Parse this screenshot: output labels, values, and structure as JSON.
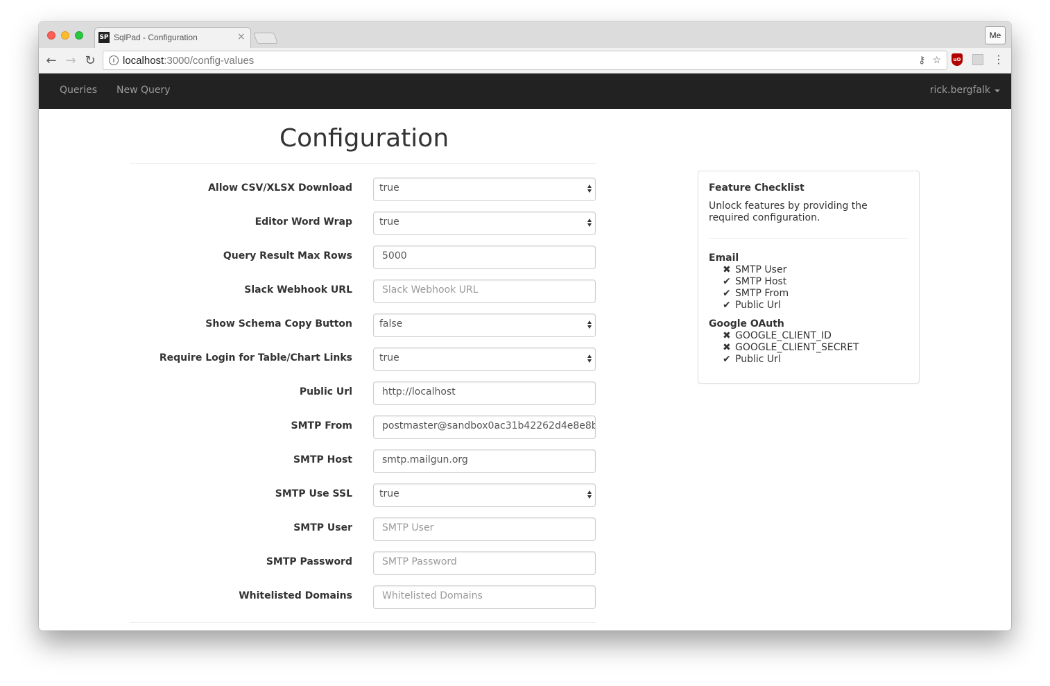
{
  "browser": {
    "tab_title": "SqlPad - Configuration",
    "favicon_text": "SP",
    "url_host": "localhost",
    "url_path": ":3000/config-values",
    "profile_label": "Me"
  },
  "navbar": {
    "queries": "Queries",
    "new_query": "New Query",
    "user": "rick.bergfalk"
  },
  "page": {
    "title": "Configuration"
  },
  "form": {
    "rows": [
      {
        "label": "Allow CSV/XLSX Download",
        "type": "select",
        "value": "true"
      },
      {
        "label": "Editor Word Wrap",
        "type": "select",
        "value": "true"
      },
      {
        "label": "Query Result Max Rows",
        "type": "input",
        "value": "5000"
      },
      {
        "label": "Slack Webhook URL",
        "type": "input",
        "placeholder": "Slack Webhook URL"
      },
      {
        "label": "Show Schema Copy Button",
        "type": "select",
        "value": "false"
      },
      {
        "label": "Require Login for Table/Chart Links",
        "type": "select",
        "value": "true"
      },
      {
        "label": "Public Url",
        "type": "input",
        "value": "http://localhost"
      },
      {
        "label": "SMTP From",
        "type": "input",
        "value": "postmaster@sandbox0ac31b42262d4e8e8b"
      },
      {
        "label": "SMTP Host",
        "type": "input",
        "value": "smtp.mailgun.org"
      },
      {
        "label": "SMTP Use SSL",
        "type": "select",
        "value": "true"
      },
      {
        "label": "SMTP User",
        "type": "input",
        "placeholder": "SMTP User"
      },
      {
        "label": "SMTP Password",
        "type": "input",
        "placeholder": "SMTP Password"
      },
      {
        "label": "Whitelisted Domains",
        "type": "input",
        "placeholder": "Whitelisted Domains"
      }
    ]
  },
  "checklist": {
    "title": "Feature Checklist",
    "description": "Unlock features by providing the required configuration.",
    "groups": [
      {
        "name": "Email",
        "items": [
          {
            "label": "SMTP User",
            "status": "missing",
            "icon": "✖"
          },
          {
            "label": "SMTP Host",
            "status": "ok",
            "icon": "✔"
          },
          {
            "label": "SMTP From",
            "status": "ok",
            "icon": "✔"
          },
          {
            "label": "Public Url",
            "status": "ok",
            "icon": "✔"
          }
        ]
      },
      {
        "name": "Google OAuth",
        "items": [
          {
            "label": "GOOGLE_CLIENT_ID",
            "status": "missing",
            "icon": "✖"
          },
          {
            "label": "GOOGLE_CLIENT_SECRET",
            "status": "missing",
            "icon": "✖"
          },
          {
            "label": "Public Url",
            "status": "ok",
            "icon": "✔"
          }
        ]
      }
    ]
  }
}
